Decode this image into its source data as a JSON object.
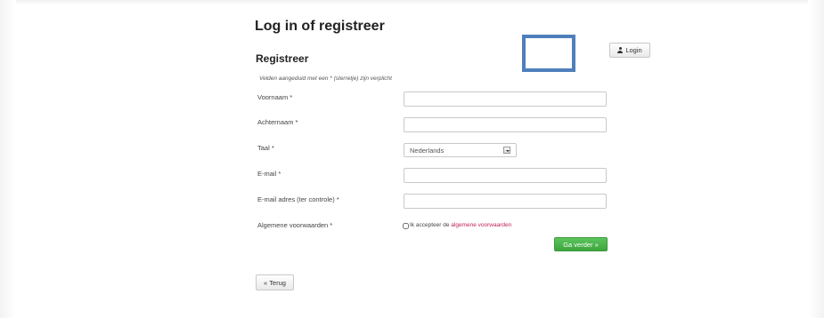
{
  "page": {
    "title": "Log in of registreer"
  },
  "header": {
    "login_label": "Login",
    "login_icon": "user-icon"
  },
  "form": {
    "section_title": "Registreer",
    "required_note": "Velden aangeduid met een * (sterretje) zijn verplicht",
    "fields": {
      "first_name": {
        "label": "Voornaam *",
        "value": "",
        "placeholder": ""
      },
      "last_name": {
        "label": "Achternaam *",
        "value": "",
        "placeholder": ""
      },
      "language": {
        "label": "Taal *",
        "selected": "Nederlands"
      },
      "email": {
        "label": "E-mail *",
        "value": "",
        "placeholder": ""
      },
      "email_confirm": {
        "label": "E-mail adres (ter controle) *",
        "value": "",
        "placeholder": ""
      },
      "terms": {
        "label": "Algemene voorwaarden *",
        "checkbox_text": "Ik accepteer de",
        "link_text": "algemene voorwaarden",
        "checked": false
      }
    },
    "continue_label": "Ga verder »",
    "back_label": "« Terug"
  },
  "colors": {
    "accent_green": "#4cb84c",
    "link_red": "#c0205a",
    "highlight_box": "#4f7fbb"
  }
}
